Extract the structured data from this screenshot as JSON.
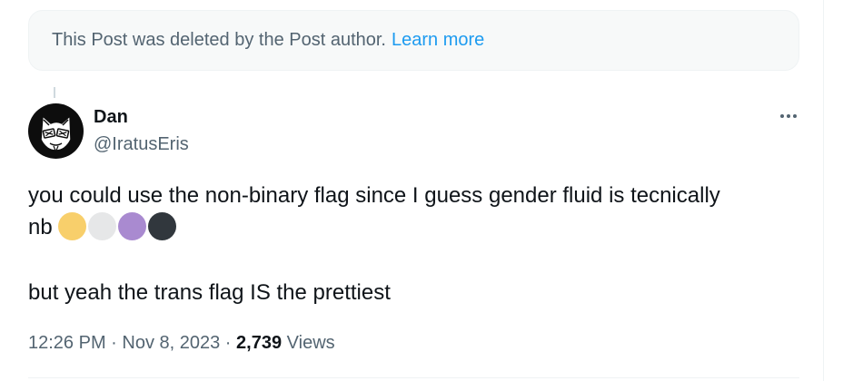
{
  "deleted_notice": {
    "text": "This Post was deleted by the Post author.",
    "link": "Learn more"
  },
  "author": {
    "name": "Dan",
    "handle": "@IratusEris",
    "avatar_icon": "cat-avatar-icon"
  },
  "more_icon": "more-options-icon",
  "tweet": {
    "line1": "you could use the non-binary flag since I guess gender fluid is tecnically",
    "line2_prefix": "nb",
    "emoji": [
      {
        "name": "yellow-circle-emoji",
        "color": "#f8cf6b"
      },
      {
        "name": "white-circle-emoji",
        "color": "#e6e7e8"
      },
      {
        "name": "purple-circle-emoji",
        "color": "#a98ad0"
      },
      {
        "name": "black-circle-emoji",
        "color": "#31373d"
      }
    ],
    "line3": "but yeah the trans flag IS the prettiest"
  },
  "meta": {
    "time": "12:26 PM",
    "sep1": " · ",
    "date": "Nov 8, 2023",
    "sep2": " · ",
    "views_count": "2,739",
    "views_label": " Views"
  },
  "colors": {
    "link": "#1d9bf0",
    "secondary_text": "#536471",
    "primary_text": "#0f1419"
  }
}
